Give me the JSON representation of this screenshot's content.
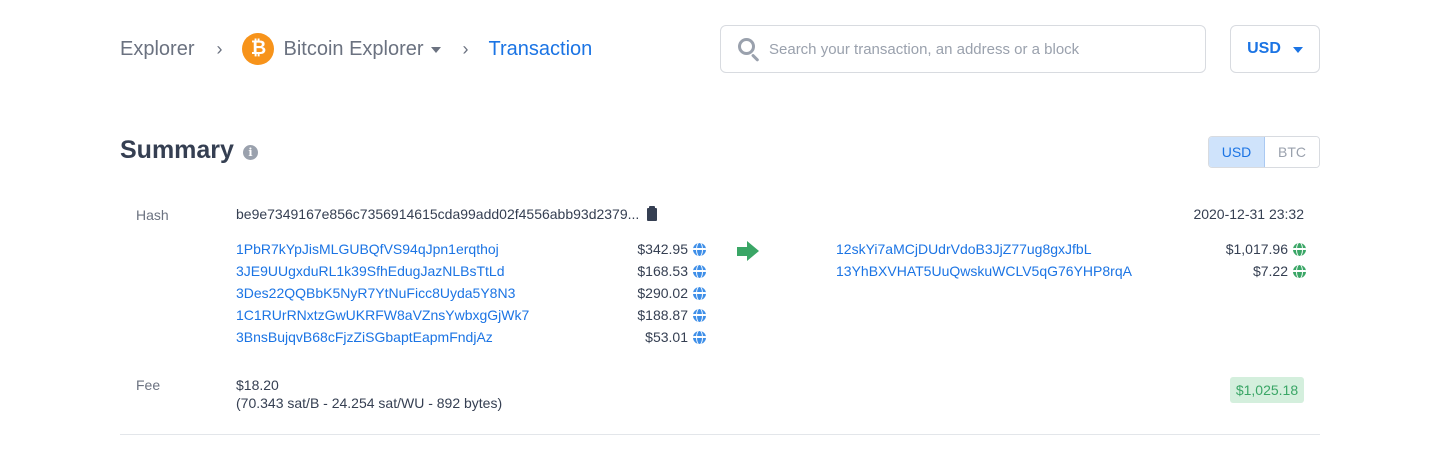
{
  "breadcrumb": {
    "explorer": "Explorer",
    "separator": "›",
    "explorer_name": "Bitcoin Explorer",
    "coin_symbol": "₿",
    "current": "Transaction"
  },
  "search": {
    "placeholder": "Search your transaction, an address or a block"
  },
  "currency_selector": {
    "label": "USD"
  },
  "summary": {
    "title": "Summary",
    "info_glyph": "i",
    "toggle": {
      "usd": "USD",
      "btc": "BTC",
      "active": "USD"
    }
  },
  "transaction": {
    "hash_label": "Hash",
    "hash": "be9e7349167e856c7356914615cda99add02f4556abb93d2379...",
    "timestamp": "2020-12-31 23:32",
    "inputs": [
      {
        "address": "1PbR7kYpJisMLGUBQfVS94qJpn1erqthoj",
        "amount": "$342.95"
      },
      {
        "address": "3JE9UUgxduRL1k39SfhEdugJazNLBsTtLd",
        "amount": "$168.53"
      },
      {
        "address": "3Des22QQBbK5NyR7YtNuFicc8Uyda5Y8N3",
        "amount": "$290.02"
      },
      {
        "address": "1C1RUrRNxtzGwUKRFW8aVZnsYwbxgGjWk7",
        "amount": "$188.87"
      },
      {
        "address": "3BnsBujqvB68cFjzZiSGbaptEapmFndjAz",
        "amount": "$53.01"
      }
    ],
    "outputs": [
      {
        "address": "12skYi7aMCjDUdrVdoB3JjZ77ug8gxJfbL",
        "amount": "$1,017.96"
      },
      {
        "address": "13YhBXVHAT5UuQwskuWCLV5qG76YHP8rqA",
        "amount": "$7.22"
      }
    ],
    "fee_label": "Fee",
    "fee_amount": "$18.20",
    "fee_details": "(70.343 sat/B - 24.254 sat/WU - 892 bytes)",
    "total": "$1,025.18"
  },
  "colors": {
    "link": "#1b74e4",
    "bitcoin": "#f7931a",
    "success": "#3aa666",
    "text": "#353f52",
    "muted": "#6b7280"
  },
  "icons": {
    "search": "search-icon",
    "info": "info-icon",
    "copy": "clipboard-icon",
    "input_globe": "globe-icon",
    "output_globe": "globe-icon",
    "flow": "arrow-right-icon"
  }
}
